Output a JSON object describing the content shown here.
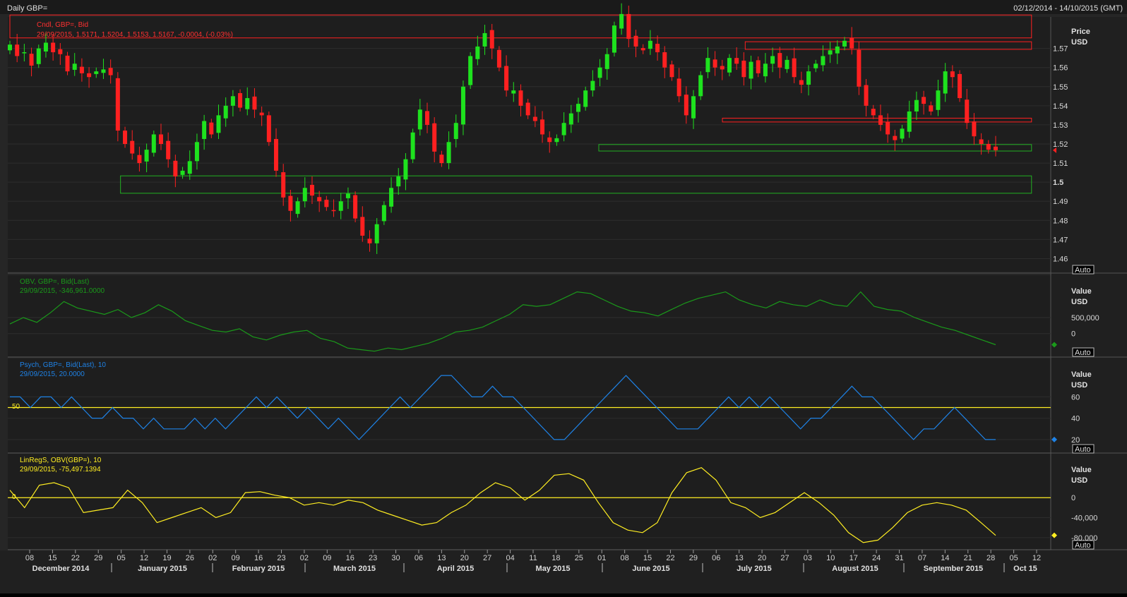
{
  "header": {
    "title": "Daily GBP=",
    "date_range": "02/12/2014 - 14/10/2015 (GMT)"
  },
  "colors": {
    "up": "#1ee21e",
    "down": "#ff2020",
    "obv": "#1a9a1a",
    "psych": "#1e82e6",
    "linreg": "#ffee22",
    "ref_line": "#ffee22",
    "zone_red": "#ff2020",
    "zone_green": "#22b022"
  },
  "price_panel": {
    "legend_line1": "Cndl, GBP=, Bid",
    "legend_line2": "29/09/2015, 1.5171, 1.5204, 1.5153, 1.5167, -0.0004, (-0.03%)",
    "axis_title": "Price",
    "axis_unit": "USD",
    "ticks": [
      "1.57",
      "1.56",
      "1.55",
      "1.54",
      "1.53",
      "1.52",
      "1.51",
      "1.5",
      "1.49",
      "1.48",
      "1.47",
      "1.46"
    ],
    "auto_label": "Auto"
  },
  "obv_panel": {
    "legend_line1": "OBV, GBP=, Bid(Last)",
    "legend_line2": "29/09/2015, -346,961.0000",
    "axis_title": "Value",
    "axis_unit": "USD",
    "ticks": [
      "500,000",
      "0"
    ],
    "auto_label": "Auto"
  },
  "psych_panel": {
    "legend_line1": "Psych, GBP=, Bid(Last),   10",
    "legend_line2": "29/09/2015, 20.0000",
    "axis_title": "Value",
    "axis_unit": "USD",
    "ticks": [
      "60",
      "40",
      "20"
    ],
    "ref_label": "50",
    "auto_label": "Auto"
  },
  "linreg_panel": {
    "legend_line1": "LinRegS, OBV(GBP=),   10",
    "legend_line2": "29/09/2015, -75,497.1394",
    "axis_title": "Value",
    "axis_unit": "USD",
    "ticks": [
      "0",
      "-40,000",
      "-80,000"
    ],
    "ref_label": "0",
    "auto_label": "Auto"
  },
  "x_axis": {
    "day_ticks": [
      "08",
      "15",
      "22",
      "29",
      "05",
      "12",
      "19",
      "26",
      "02",
      "09",
      "16",
      "23",
      "02",
      "09",
      "16",
      "23",
      "30",
      "06",
      "13",
      "20",
      "27",
      "04",
      "11",
      "18",
      "25",
      "01",
      "08",
      "15",
      "22",
      "29",
      "06",
      "13",
      "20",
      "27",
      "03",
      "10",
      "17",
      "24",
      "31",
      "07",
      "14",
      "21",
      "28",
      "05",
      "12"
    ],
    "months": [
      "December 2014",
      "January 2015",
      "February 2015",
      "March 2015",
      "April 2015",
      "May 2015",
      "June 2015",
      "July 2015",
      "August 2015",
      "September 2015",
      "Oct 15"
    ]
  },
  "chart_data": [
    {
      "type": "candlestick",
      "title": "Daily GBP=",
      "series_name": "Cndl, GBP=, Bid",
      "x_range": [
        "2014-12-02",
        "2015-10-14"
      ],
      "ylim": [
        1.455,
        1.585
      ],
      "last": {
        "date": "29/09/2015",
        "open": 1.5171,
        "high": 1.5204,
        "low": 1.5153,
        "close": 1.5167
      },
      "closes_approx": [
        1.572,
        1.566,
        1.568,
        1.561,
        1.57,
        1.573,
        1.568,
        1.567,
        1.558,
        1.562,
        1.557,
        1.555,
        1.558,
        1.559,
        1.556,
        1.527,
        1.52,
        1.515,
        1.51,
        1.517,
        1.525,
        1.52,
        1.512,
        1.503,
        1.506,
        1.511,
        1.521,
        1.532,
        1.525,
        1.535,
        1.54,
        1.545,
        1.539,
        1.544,
        1.538,
        1.535,
        1.521,
        1.506,
        1.492,
        1.485,
        1.49,
        1.497,
        1.493,
        1.49,
        1.487,
        1.485,
        1.49,
        1.494,
        1.481,
        1.472,
        1.468,
        1.478,
        1.488,
        1.497,
        1.503,
        1.512,
        1.526,
        1.538,
        1.53,
        1.516,
        1.51,
        1.521,
        1.531,
        1.55,
        1.566,
        1.571,
        1.578,
        1.57,
        1.56,
        1.548,
        1.548,
        1.54,
        1.535,
        1.532,
        1.525,
        1.521,
        1.523,
        1.531,
        1.536,
        1.541,
        1.548,
        1.553,
        1.56,
        1.567,
        1.582,
        1.588,
        1.575,
        1.571,
        1.569,
        1.574,
        1.568,
        1.56,
        1.555,
        1.545,
        1.535,
        1.545,
        1.556,
        1.565,
        1.56,
        1.559,
        1.565,
        1.562,
        1.555,
        1.563,
        1.557,
        1.562,
        1.566,
        1.56,
        1.564,
        1.555,
        1.551,
        1.558,
        1.562,
        1.566,
        1.569,
        1.571,
        1.574,
        1.57,
        1.55,
        1.54,
        1.535,
        1.53,
        1.525,
        1.522,
        1.528,
        1.537,
        1.543,
        1.541,
        1.537,
        1.548,
        1.558,
        1.555,
        1.544,
        1.531,
        1.524,
        1.52,
        1.517,
        1.5167
      ],
      "zones": [
        {
          "color": "red",
          "y_range": [
            1.5735,
            1.5695
          ],
          "x_range": [
            "2015-07-16",
            "2015-10-12"
          ]
        },
        {
          "color": "red",
          "y_range": [
            1.5335,
            1.5315
          ],
          "x_range": [
            "2015-07-09",
            "2015-10-12"
          ]
        },
        {
          "color": "green",
          "y_range": [
            1.5197,
            1.5163
          ],
          "x_range": [
            "2015-06-01",
            "2015-10-12"
          ]
        },
        {
          "color": "green",
          "y_range": [
            1.5033,
            1.4942
          ],
          "x_range": [
            "2015-01-05",
            "2015-10-12"
          ]
        },
        {
          "color": "red",
          "y_range": [
            1.5875,
            1.5755
          ],
          "x_range": [
            "2014-12-02",
            "2015-10-12"
          ]
        }
      ]
    },
    {
      "type": "line",
      "series_name": "OBV, GBP=, Bid(Last)",
      "ylim": [
        -600000,
        1600000
      ],
      "ticks": [
        500000,
        0
      ],
      "values_approx": [
        300000,
        500000,
        350000,
        650000,
        1000000,
        800000,
        700000,
        600000,
        750000,
        500000,
        650000,
        900000,
        700000,
        400000,
        250000,
        100000,
        50000,
        150000,
        -100000,
        -200000,
        -50000,
        50000,
        100000,
        -150000,
        -250000,
        -450000,
        -500000,
        -550000,
        -450000,
        -500000,
        -400000,
        -300000,
        -150000,
        50000,
        100000,
        200000,
        400000,
        600000,
        900000,
        850000,
        900000,
        1100000,
        1300000,
        1250000,
        1050000,
        850000,
        700000,
        650000,
        550000,
        750000,
        950000,
        1100000,
        1200000,
        1300000,
        1050000,
        900000,
        800000,
        1000000,
        900000,
        850000,
        1050000,
        900000,
        850000,
        1300000,
        850000,
        750000,
        700000,
        500000,
        350000,
        200000,
        100000,
        -50000,
        -200000,
        -346961
      ]
    },
    {
      "type": "line",
      "series_name": "Psych, GBP=, Bid(Last), 10",
      "ylim": [
        10,
        92
      ],
      "reference": 50,
      "values_approx": [
        60,
        60,
        50,
        60,
        60,
        50,
        60,
        50,
        40,
        40,
        50,
        40,
        40,
        30,
        40,
        30,
        30,
        30,
        40,
        30,
        40,
        30,
        40,
        50,
        60,
        50,
        60,
        50,
        40,
        50,
        40,
        30,
        40,
        30,
        20,
        30,
        40,
        50,
        60,
        50,
        60,
        70,
        80,
        80,
        70,
        60,
        60,
        70,
        60,
        60,
        50,
        40,
        30,
        20,
        20,
        30,
        40,
        50,
        60,
        70,
        80,
        70,
        60,
        50,
        40,
        30,
        30,
        30,
        40,
        50,
        60,
        50,
        60,
        50,
        60,
        50,
        40,
        30,
        40,
        40,
        50,
        60,
        70,
        60,
        60,
        50,
        40,
        30,
        20,
        30,
        30,
        40,
        50,
        40,
        30,
        20,
        20
      ]
    },
    {
      "type": "line",
      "series_name": "LinRegS, OBV(GBP=), 10",
      "ylim": [
        -100000,
        78000
      ],
      "reference": 0,
      "values_approx": [
        15000,
        -20000,
        25000,
        30000,
        20000,
        -30000,
        -25000,
        -20000,
        15000,
        -10000,
        -50000,
        -40000,
        -30000,
        -20000,
        -40000,
        -30000,
        10000,
        12000,
        5000,
        0,
        -15000,
        -10000,
        -15000,
        -5000,
        -10000,
        -25000,
        -35000,
        -45000,
        -55000,
        -50000,
        -30000,
        -15000,
        10000,
        30000,
        20000,
        -5000,
        15000,
        45000,
        48000,
        35000,
        -10000,
        -50000,
        -65000,
        -70000,
        -50000,
        10000,
        50000,
        60000,
        35000,
        -10000,
        -20000,
        -40000,
        -30000,
        -10000,
        10000,
        -10000,
        -35000,
        -70000,
        -90000,
        -85000,
        -60000,
        -30000,
        -15000,
        -10000,
        -15000,
        -25000,
        -50000,
        -75497
      ]
    }
  ]
}
